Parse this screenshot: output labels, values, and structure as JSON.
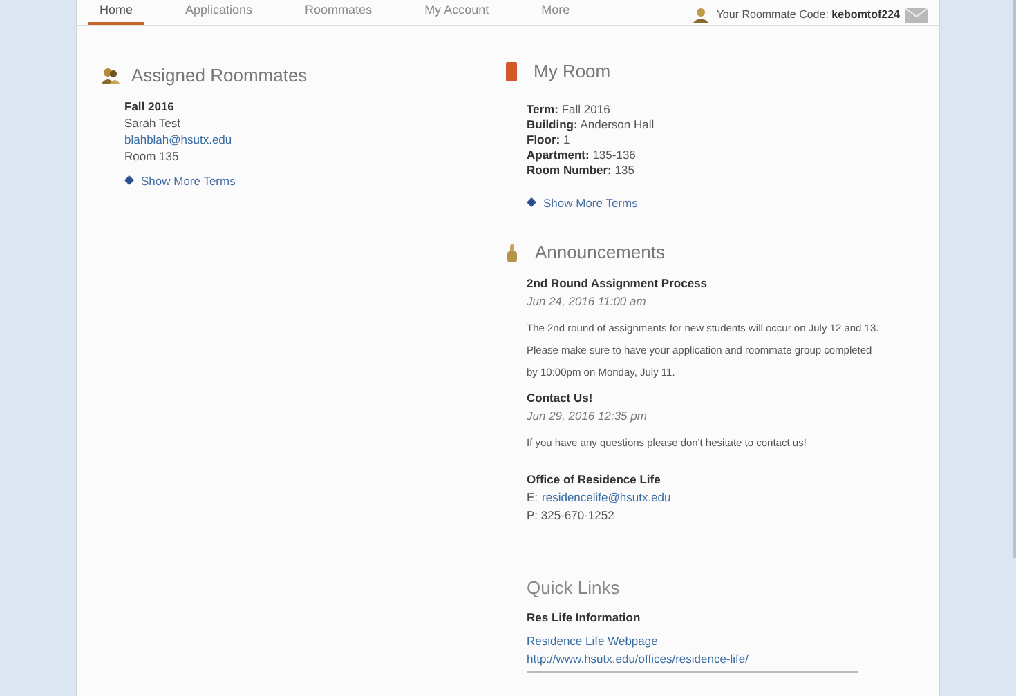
{
  "nav": {
    "tabs": [
      {
        "label": "Home",
        "selected": true
      },
      {
        "label": "Applications",
        "selected": false
      },
      {
        "label": "Roommates",
        "selected": false
      },
      {
        "label": "My Account",
        "selected": false
      },
      {
        "label": "More",
        "selected": false
      }
    ],
    "roommate_code_label": "Your Roommate Code:",
    "roommate_code": "kebomtof224"
  },
  "assigned_roommates": {
    "title": "Assigned Roommates",
    "term": "Fall 2016",
    "name": "Sarah Test",
    "email": "blahblah@hsutx.edu",
    "room": "Room 135",
    "more_link": "Show More Terms"
  },
  "my_room": {
    "title": "My Room",
    "fields": [
      {
        "label": "Term:",
        "value": "Fall 2016"
      },
      {
        "label": "Building:",
        "value": "Anderson Hall"
      },
      {
        "label": "Floor:",
        "value": "1"
      },
      {
        "label": "Apartment:",
        "value": "135-136"
      },
      {
        "label": "Room Number:",
        "value": "135"
      }
    ],
    "more_link": "Show More Terms"
  },
  "announcements": {
    "title": "Announcements",
    "items": [
      {
        "title": "2nd Round Assignment Process",
        "date": "Jun 24, 2016 11:00 am",
        "body": "The 2nd round of assignments for new students will occur on July 12 and 13. Please make sure to have your application and roommate group completed by 10:00pm on Monday, July 11."
      },
      {
        "title": "Contact Us!",
        "date": "Jun 29, 2016 12:35 pm",
        "body": "If you have any questions please don't hesitate to contact us!"
      }
    ],
    "office": {
      "title": "Office of Residence Life",
      "email_label": "E:",
      "email": "residencelife@hsutx.edu",
      "phone": "P: 325-670-1252"
    }
  },
  "quick_links": {
    "title": "Quick Links",
    "section": "Res Life Information",
    "links": [
      "Residence Life Webpage",
      "http://www.hsutx.edu/offices/residence-life/"
    ]
  }
}
